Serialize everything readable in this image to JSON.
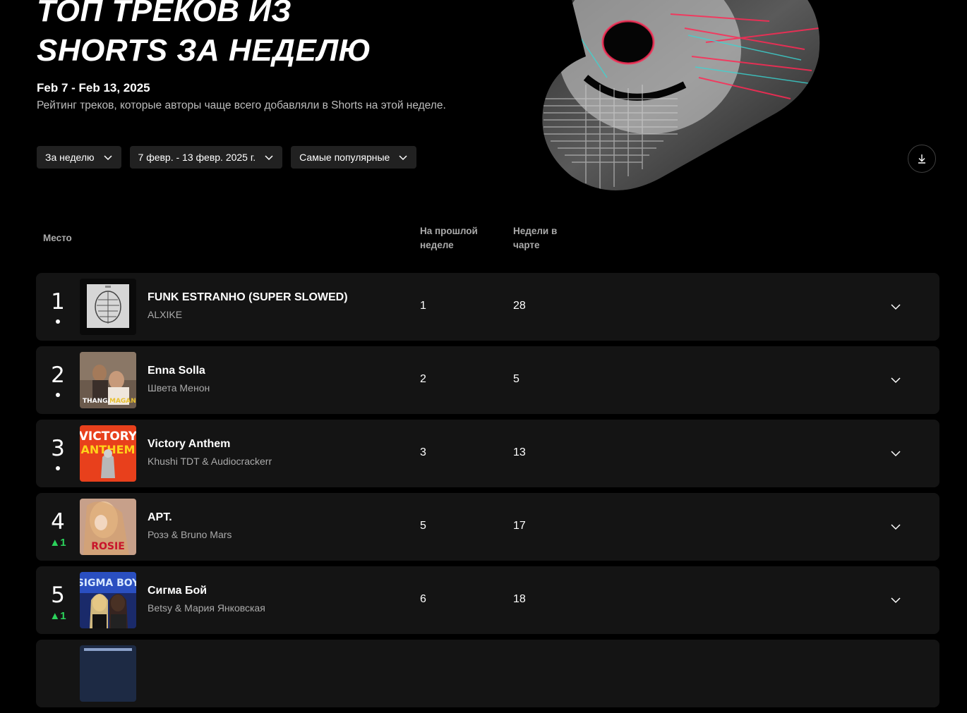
{
  "header": {
    "title_line1": "ТОП ТРЕКОВ ИЗ",
    "title_line2": "SHORTS ЗА НЕДЕЛЮ",
    "date_range": "Feb 7 - Feb 13, 2025",
    "subtitle": "Рейтинг треков, которые авторы чаще всего добавляли в Shorts на этой неделе."
  },
  "filters": {
    "period": "За неделю",
    "dates": "7 февр. - 13 февр. 2025 г.",
    "sort": "Самые популярные"
  },
  "columns": {
    "rank": "Место",
    "last_week_line1": "На прошлой",
    "last_week_line2": "неделе",
    "weeks_line1": "Недели в",
    "weeks_line2": "чарте"
  },
  "icons": {
    "download": "download-icon",
    "chevron": "chevron-down-icon"
  },
  "colors": {
    "accent_up": "#2bd25b",
    "row_bg": "#141414",
    "chip_bg": "#212121"
  },
  "tracks": [
    {
      "rank": "1",
      "change": "",
      "title": "FUNK ESTRANHO (SUPER SLOWED)",
      "artist": "ALXIKE",
      "last_week": "1",
      "weeks": "28"
    },
    {
      "rank": "2",
      "change": "",
      "title": "Enna Solla",
      "artist": "Швета Менон",
      "last_week": "2",
      "weeks": "5",
      "cover_text_1": "THANGA",
      "cover_text_2": "MAGAN"
    },
    {
      "rank": "3",
      "change": "",
      "title": "Victory Anthem",
      "artist": "Khushi TDT & Audiocrackerr",
      "last_week": "3",
      "weeks": "13",
      "cover_text_1": "VICTORY",
      "cover_text_2": "ANTHEM"
    },
    {
      "rank": "4",
      "change": "▲1",
      "title": "APT.",
      "artist": "Розэ & Bruno Mars",
      "last_week": "5",
      "weeks": "17",
      "cover_text_1": "ROSIE"
    },
    {
      "rank": "5",
      "change": "▲1",
      "title": "Сигма Бой",
      "artist": "Betsy & Мария Янковская",
      "last_week": "6",
      "weeks": "18",
      "cover_text_1": "SIGMA BOY"
    }
  ]
}
